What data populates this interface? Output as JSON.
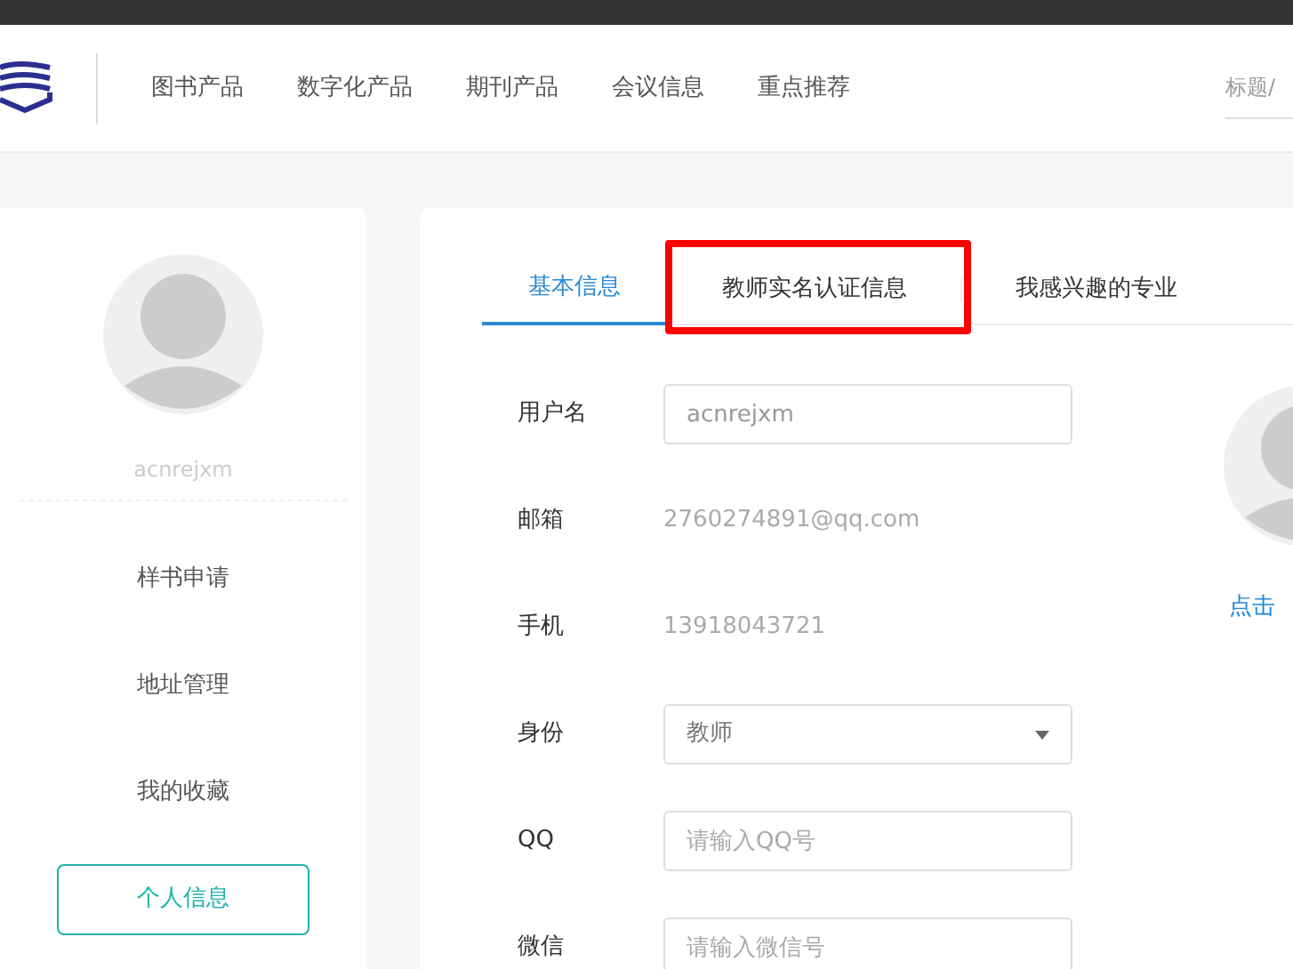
{
  "nav": {
    "items": [
      "图书产品",
      "数字化产品",
      "期刊产品",
      "会议信息",
      "重点推荐"
    ],
    "search": {
      "placeholder": "标题/"
    }
  },
  "sidebar": {
    "username": "acnrejxm",
    "items": [
      {
        "label": "样书申请",
        "selected": false
      },
      {
        "label": "地址管理",
        "selected": false
      },
      {
        "label": "我的收藏",
        "selected": false
      },
      {
        "label": "个人信息",
        "selected": true
      }
    ]
  },
  "tabs": [
    {
      "label": "基本信息",
      "selected": true,
      "highlighted": false
    },
    {
      "label": "教师实名认证信息",
      "selected": false,
      "highlighted": true
    },
    {
      "label": "我感兴趣的专业",
      "selected": false,
      "highlighted": false
    }
  ],
  "form": [
    {
      "kind": "input",
      "label": "用户名",
      "value": "acnrejxm"
    },
    {
      "kind": "text",
      "label": "邮箱",
      "value": "2760274891@qq.com"
    },
    {
      "kind": "text",
      "label": "手机",
      "value": "13918043721"
    },
    {
      "kind": "select",
      "label": "身份",
      "value": "教师"
    },
    {
      "kind": "input",
      "label": "QQ",
      "placeholder": "请输入QQ号"
    },
    {
      "kind": "input",
      "label": "微信",
      "placeholder": "请输入微信号"
    }
  ],
  "avatar_link": "点击"
}
